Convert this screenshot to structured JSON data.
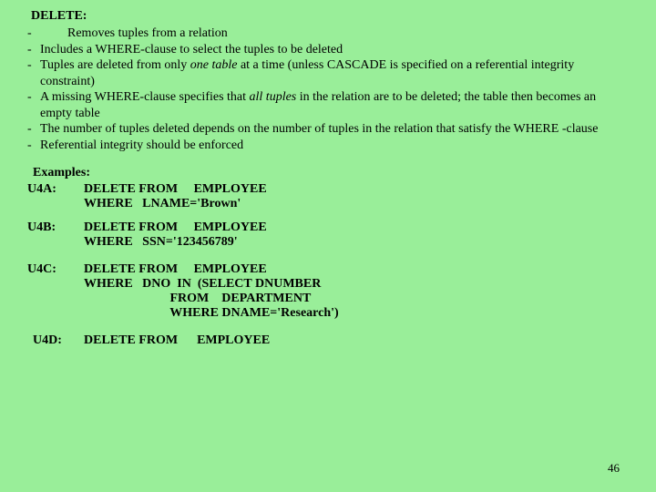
{
  "title": "DELETE:",
  "bullets": [
    {
      "prefix": "-",
      "indent": true,
      "text": "Removes tuples from a relation"
    },
    {
      "prefix": "-",
      "text": "Includes a WHERE-clause to select the tuples to be deleted"
    },
    {
      "prefix": "-",
      "html": "Tuples are deleted from only <span class=\"it\">one table</span>  at a time (unless CASCADE is specified on a referential integrity constraint)"
    },
    {
      "prefix": "-",
      "html": "A missing WHERE-clause specifies that <span class=\"it\">all tuples</span>  in the relation are to be deleted; the table then becomes an empty table"
    },
    {
      "prefix": "-",
      "text": "The number of tuples deleted depends on the number of tuples in the relation that satisfy the WHERE -clause"
    },
    {
      "prefix": "-",
      "text": "Referential integrity should be enforced"
    }
  ],
  "examples_heading": "Examples:",
  "examples": [
    {
      "label": "U4A:",
      "code": "DELETE FROM     EMPLOYEE\nWHERE   LNAME='Brown'"
    },
    {
      "label": "U4B:",
      "code": "DELETE FROM     EMPLOYEE\nWHERE   SSN='123456789'"
    },
    {
      "label": "U4C:",
      "code": "DELETE FROM     EMPLOYEE\nWHERE   DNO  IN  (SELECT DNUMBER\n                           FROM    DEPARTMENT\n                           WHERE DNAME='Research')"
    },
    {
      "label": "U4D:",
      "code": "DELETE FROM      EMPLOYEE",
      "shift": true
    }
  ],
  "page_number": "46"
}
